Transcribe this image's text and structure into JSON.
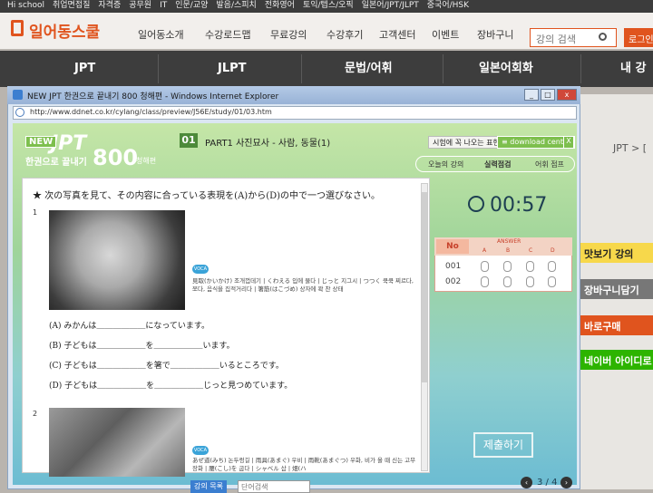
{
  "site": {
    "top_links": [
      "Hi school",
      "취업면접질",
      "자격증",
      "공무원",
      "IT",
      "인문/교양",
      "발음/스피치",
      "전화영어",
      "토익/텝스/오픽",
      "일본어/JPT/JLPT",
      "중국어/HSK"
    ],
    "logo_text": "일어동스쿨",
    "nav_items": [
      "일어동소개",
      "수강로드맵",
      "무료강의",
      "수강후기",
      "고객센터",
      "이벤트",
      "장바구니"
    ],
    "search_placeholder": "강의 검색",
    "login_label": "로그인",
    "main_menu": [
      "JPT",
      "JLPT",
      "문법/어휘",
      "일본어회화",
      "내 강의"
    ],
    "breadcrumb": "JPT > [",
    "side_buttons": [
      "맛보기 강의",
      "장바구니담기",
      "바로구매",
      "네이버 아이디로"
    ]
  },
  "browser": {
    "title": "NEW JPT 한권으로 끝내기 800 청해편 - Windows Internet Explorer",
    "url": "http://www.ddnet.co.kr/cylang/class/preview/J56E/study/01/03.htm"
  },
  "player": {
    "brand_new": "NEW",
    "brand_jpt": "JPT",
    "brand_subtitle": "한권으로 끝내기",
    "brand_800": "800",
    "brand_edition": "청해편",
    "unit_number": "01",
    "unit_title": "PART1 사진묘사 - 사람, 동물(1)",
    "exam_button": "시험에 꼭 나오는 표현",
    "download_button": "≡ download center",
    "close_label": "X",
    "tabs": [
      "오늘의 강의",
      "실력점검",
      "어휘 점프"
    ],
    "instruction": "★ 次の写真を見て、その内容に合っている表現を(A)から(D)の中で一つ選びなさい。",
    "vocab_badge": "VOCA",
    "questions": [
      {
        "number": "1",
        "vocab": "見取(かいかけ) 조개껍데기 | くわえる 입에 물다 | じっと 지그시 | つつく 쿡쿡 찌르다, 쪼다, 음식을 집적거리다 | 箸筋(はこづめ) 상자에 꽉 찬 상태",
        "choices": [
          "(A) みかんは＿＿＿＿＿＿になっています。",
          "(B) 子どもは＿＿＿＿＿＿を＿＿＿＿＿＿います。",
          "(C) 子どもは＿＿＿＿＿＿を箸で＿＿＿＿＿＿いるところです。",
          "(D) 子どもは＿＿＿＿＿＿を＿＿＿＿＿＿じっと見つめています。"
        ]
      },
      {
        "number": "2",
        "vocab": "あぜ道(みち) 논두렁길 | 雨具(あまぐ) 우비 | 雨靴(あまぐつ) 우화, 비가 올 때 신는 고무장화 | 腰(こし)を 굽다 | シャベル 삽 | 畑(ハ"
      }
    ],
    "timer": "00:57",
    "answer_header": "ANSWER",
    "answer_no": "No",
    "answer_options": [
      "A",
      "B",
      "C",
      "D"
    ],
    "answer_rows": [
      "001",
      "002"
    ],
    "submit_label": "제출하기",
    "page_indicator": "3 / 4",
    "bottom_chip": "강의 목록",
    "bottom_search": "단어검색"
  },
  "colors": {
    "brand_orange": "#e0541e",
    "nav_dark": "#3d3d3d",
    "player_green": "#7dbf4d",
    "timer_text": "#1e3f52"
  }
}
